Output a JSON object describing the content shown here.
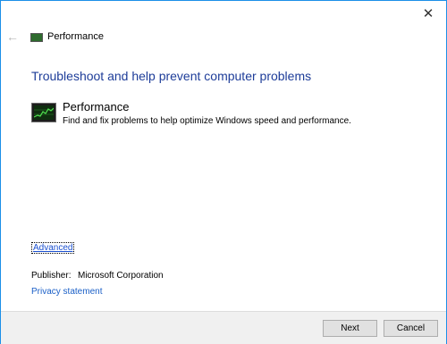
{
  "window": {
    "close_glyph": "✕"
  },
  "header": {
    "back_glyph": "←",
    "title": "Performance"
  },
  "main": {
    "heading": "Troubleshoot and help prevent computer problems",
    "item": {
      "title": "Performance",
      "description": "Find and fix problems to help optimize Windows speed and performance.",
      "icon": "performance-monitor-icon"
    },
    "advanced_label": "Advanced",
    "publisher_label": "Publisher:",
    "publisher_value": "Microsoft Corporation",
    "privacy_label": "Privacy statement"
  },
  "footer": {
    "next_label": "Next",
    "cancel_label": "Cancel"
  },
  "colors": {
    "border": "#1b8fe8",
    "heading": "#1e3d99",
    "link": "#1a5fc7",
    "footer_bg": "#f0f0f0"
  }
}
